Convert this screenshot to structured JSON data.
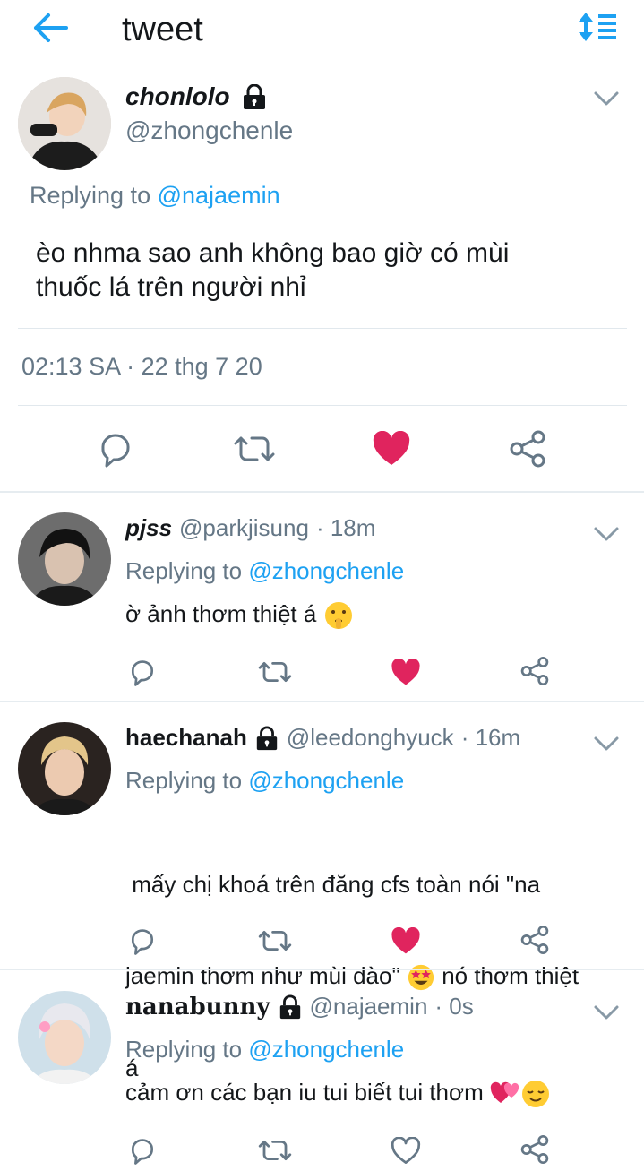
{
  "header": {
    "title": "tweet",
    "back_icon": "arrow-left-icon",
    "sort_icon": "sort-icon",
    "accent": "#1da1f2"
  },
  "main_tweet": {
    "display_name": "chonlolo",
    "handle": "@zhongchenle",
    "replying_prefix": "Replying to",
    "replying_to": "@najaemin",
    "text_line1": "èo nhma sao anh không bao giờ có mùi",
    "text_line2": "thuốc lá trên người nhỉ",
    "timestamp": "02:13 SA · 22 thg 7 20",
    "liked": true
  },
  "replies": [
    {
      "display_name": "pjss",
      "handle": "@parkjisung",
      "time": "· 18m",
      "replying_prefix": "Replying to",
      "replying_to": "@zhongchenle",
      "text": "ờ ảnh thơm thiệt á",
      "liked": true
    },
    {
      "display_name": "haechanah",
      "handle": "@leedonghyuck",
      "time": "· 16m",
      "replying_prefix": "Replying to",
      "replying_to": "@zhongchenle",
      "text_line1": " mấy chị khoá trên đăng cfs toàn nói \"na",
      "text_line2a": "jaemin thơm như mùi đào\"",
      "text_line2b": "nó thơm thiệt",
      "text_line3": "á",
      "liked": true
    },
    {
      "display_name": "nanabunny",
      "handle": "@najaemin",
      "time": "· 0s",
      "replying_prefix": "Replying to",
      "replying_to": "@zhongchenle",
      "text": "cảm ơn các bạn iu tui biết tui thơm",
      "liked": false
    }
  ],
  "colors": {
    "like": "#e0245e",
    "icon_gray": "#657786",
    "link": "#1da1f2"
  }
}
